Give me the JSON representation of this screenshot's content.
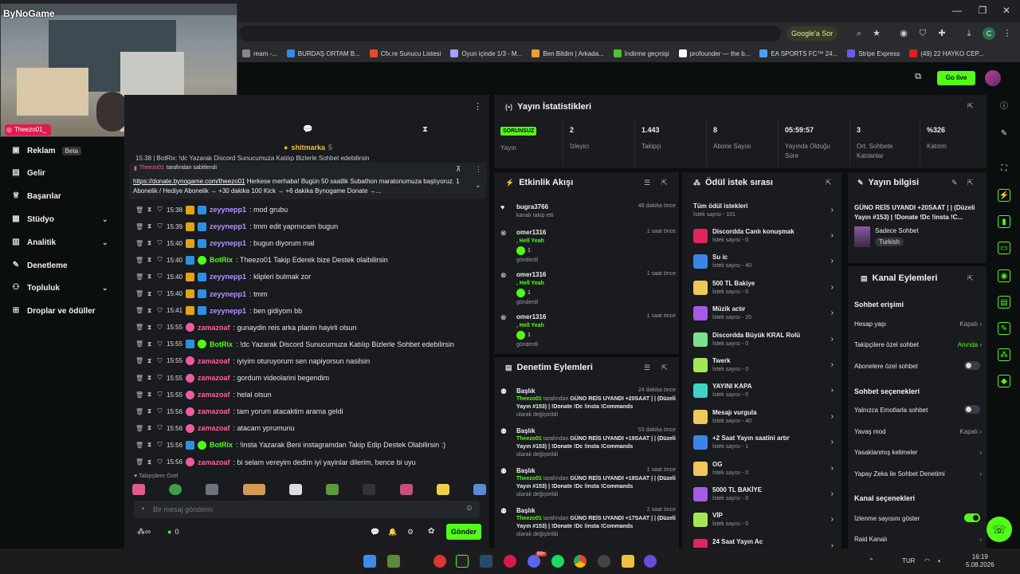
{
  "browser": {
    "google_ask": "Google'a Sor",
    "profile_initial": "C",
    "bookmarks": [
      "ream -...",
      "BURDAŞ ORTAM B...",
      "Cfx.re Sunucu Listesi",
      "Oyun içinde 1/3 - M...",
      "Ben Bildim | Arkada...",
      "İndirme geçmişi",
      "profounder — the b...",
      "EA SPORTS FC™ 24...",
      "Stripe Express",
      "(49) 22 HAYKO CEP..."
    ]
  },
  "header": {
    "go_live": "Go live"
  },
  "webcam": {
    "logo": "ByNoGame",
    "name": "Theezo01_"
  },
  "nav": {
    "items": [
      {
        "label": "Reklam",
        "badge": "Beta"
      },
      {
        "label": "Gelir"
      },
      {
        "label": "Başarılar"
      },
      {
        "label": "Stüdyo"
      },
      {
        "label": "Analitik"
      },
      {
        "label": "Denetleme"
      },
      {
        "label": "Topluluk"
      },
      {
        "label": "Droplar ve ödüller"
      }
    ]
  },
  "chat": {
    "gift_user": "shitmarka",
    "gift_count": "5",
    "partial_top": "15:38 | BotRix: !dc Yazarak Discord Sunucumuza Katılıp Bizlerle Sohbet edebilirsin",
    "pinned_by": "Theezo01",
    "pinned_label": "tarafından sabitlendi",
    "pinned_link": "https://donate.bynogame.com/theezo01",
    "pinned_text": "Herkese merhaba! Bugün 50 saatlik Subathon maratonumuza başlıyoruz. 1 Abonelik / Hediye Abonelik → +30 dakika 100 Kick → +6 dakika Bynogame Donate →...",
    "messages": [
      {
        "time": "15:38",
        "user": "zeyynepp1",
        "text": ": mod grubu",
        "type": "zey"
      },
      {
        "time": "15:39",
        "user": "zeyynepp1",
        "text": ": tmm edit yapmıcam bugun",
        "type": "zey"
      },
      {
        "time": "15:40",
        "user": "zeyynepp1",
        "text": ": bugun diyorum mal",
        "type": "zey"
      },
      {
        "time": "15:40",
        "user": "BotRix",
        "text": ": Theezo01 Takip Ederek bize Destek olaibilirsin",
        "type": "bot"
      },
      {
        "time": "15:40",
        "user": "zeyynepp1",
        "text": ": klipleri bulmak zor",
        "type": "zey"
      },
      {
        "time": "15:40",
        "user": "zeyynepp1",
        "text": ": tmm",
        "type": "zey"
      },
      {
        "time": "15:41",
        "user": "zeyynepp1",
        "text": ": ben gidiyom bb",
        "type": "zey"
      },
      {
        "time": "15:55",
        "user": "zamazoaf",
        "text": ": gunaydin reis arka planin hayirli olsun",
        "type": "zam"
      },
      {
        "time": "15:55",
        "user": "BotRix",
        "text": ": !dc Yazarak Discord Sunucumuza Katılıp Bizlerle Sohbet edebilirsin",
        "type": "bot"
      },
      {
        "time": "15:55",
        "user": "zamazoaf",
        "text": ": iyiyim oturuyorum sen napiyorsun nasilsin",
        "type": "zam"
      },
      {
        "time": "15:55",
        "user": "zamazoaf",
        "text": ": gordum videolarini begendim",
        "type": "zam"
      },
      {
        "time": "15:55",
        "user": "zamazoaf",
        "text": ": helal olsun",
        "type": "zam"
      },
      {
        "time": "15:56",
        "user": "zamazoaf",
        "text": ": tam yorum atacaktim arama geldi",
        "type": "zam"
      },
      {
        "time": "15:56",
        "user": "zamazoaf",
        "text": ": atacam yprumunu",
        "type": "zam"
      },
      {
        "time": "15:56",
        "user": "BotRix",
        "text": ": !insta Yazarak Beni instagramdan Takip Edip Destek Olabilirsin :)",
        "type": "bot"
      },
      {
        "time": "15:56",
        "user": "zamazoaf",
        "text": ": bi selam vereyim dedim iyi yayinlar dilerim, bence bi uyu",
        "type": "zam"
      }
    ],
    "followers_only": "Takipçilere Özel",
    "input_placeholder": "Bir mesaj gönderin",
    "send": "Gönder",
    "points": "0"
  },
  "stats": {
    "title": "Yayın İstatistikleri",
    "items": [
      {
        "value": "SORUNSUZ",
        "label": "Yayın"
      },
      {
        "value": "2",
        "label": "İzleyici"
      },
      {
        "value": "1.443",
        "label": "Takipçi"
      },
      {
        "value": "8",
        "label": "Abone Sayısı"
      },
      {
        "value": "05:59:57",
        "label": "Yayında Olduğu Süre"
      },
      {
        "value": "3",
        "label": "Ort. Sohbete Katılanlar"
      },
      {
        "value": "%326",
        "label": "Katılım"
      }
    ]
  },
  "activity": {
    "title": "Etkinlik Akışı",
    "items": [
      {
        "name": "bugra3766",
        "sub": "kanalı takip etti",
        "time": "48 dakika önce"
      },
      {
        "name": "omer1316",
        "reward": ", Hell Yeah",
        "count": "1",
        "sub": "gönderdi",
        "time": "1 saat önce"
      },
      {
        "name": "omer1316",
        "reward": ", Hell Yeah",
        "count": "1",
        "sub": "gönderdi",
        "time": "1 saat önce"
      },
      {
        "name": "omer1316",
        "reward": ", Hell Yeah",
        "count": "1",
        "sub": "gönderdi",
        "time": "1 saat önce"
      }
    ]
  },
  "moderation": {
    "title": "Denetim Eylemleri",
    "items": [
      {
        "head": "Başlık",
        "time": "24 dakika önce",
        "by": "Theezo01",
        "mid": "tarafından",
        "text": "GÜNO REİS UYANDI +20SAAT | | (Düzeli Yayın #153) | !Donate !Dc !insta !Commands",
        "tail": "olarak değiştirildi"
      },
      {
        "head": "Başlık",
        "time": "53 dakika önce",
        "by": "Theezo01",
        "mid": "tarafından",
        "text": "GÜNO REİS UYANDI +19SAAT | | (Düzeli Yayın #153) | !Donate !Dc !insta !Commands",
        "tail": "olarak değiştirildi"
      },
      {
        "head": "Başlık",
        "time": "1 saat önce",
        "by": "Theezo01",
        "mid": "tarafından",
        "text": "GÜNO REİS UYANDI +18SAAT | | (Düzeli Yayın #153) | !Donate !Dc !insta !Commands",
        "tail": "olarak değiştirildi"
      },
      {
        "head": "Başlık",
        "time": "2 saat önce",
        "by": "Theezo01",
        "mid": "tarafından",
        "text": "GÜNO REİS UYANDI +17SAAT | | (Düzeli Yayın #153) | !Donate !Dc !insta !Commands",
        "tail": "olarak değiştirildi"
      }
    ]
  },
  "rewards": {
    "title": "Ödül istek sırası",
    "all": {
      "name": "Tüm ödül istekleri",
      "sub": "İstek sayısı - 101"
    },
    "items": [
      {
        "name": "Discordda Canlı konuşmak",
        "sub": "İstek sayısı - 0",
        "color": "#e3245c"
      },
      {
        "name": "Su ic",
        "sub": "İstek sayısı - 40",
        "color": "#3a86e8"
      },
      {
        "name": "500 TL Bakiye",
        "sub": "İstek sayısı - 0",
        "color": "#f0c75a"
      },
      {
        "name": "Müzik actır",
        "sub": "İstek sayısı - 20",
        "color": "#a55be8"
      },
      {
        "name": "Discordda Büyük KRAL Rolü",
        "sub": "İstek sayısı - 0",
        "color": "#7de08a"
      },
      {
        "name": "Twerk",
        "sub": "İstek sayısı - 0",
        "color": "#a3e854"
      },
      {
        "name": "YAYINI KAPA",
        "sub": "İstek sayısı - 0",
        "color": "#3fd3c4"
      },
      {
        "name": "Mesajı vurgula",
        "sub": "İstek sayısı - 40",
        "color": "#f0c75a"
      },
      {
        "name": "+2 Saat Yayın saatini artır",
        "sub": "İstek sayısı - 1",
        "color": "#3a86e8"
      },
      {
        "name": "OG",
        "sub": "İstek sayısı - 0",
        "color": "#f0c75a"
      },
      {
        "name": "5000 TL BAKİYE",
        "sub": "İstek sayısı - 0",
        "color": "#a55be8"
      },
      {
        "name": "VİP",
        "sub": "İstek sayısı - 0",
        "color": "#a3e854"
      },
      {
        "name": "24 Saat Yayın Ac",
        "sub": "",
        "color": "#e3245c"
      }
    ]
  },
  "streaminfo": {
    "title": "Yayın bilgisi",
    "stream_title": "GÜNO REİS UYANDI +20SAAT | | (Düzeli Yayın #153) | !Donate !Dc !insta !C...",
    "category": "Sadece Sohbet",
    "language": "Turkish"
  },
  "channel": {
    "title": "Kanal Eylemleri",
    "chat_access": "Sohbet erişimi",
    "rows1": [
      {
        "label": "Hesap yaşı",
        "value": "Kapalı"
      },
      {
        "label": "Takipçilere özel sohbet",
        "value": "Anında"
      },
      {
        "label": "Abonelere özel sohbet",
        "value": ""
      }
    ],
    "chat_options": "Sohbet seçenekleri",
    "rows2": [
      {
        "label": "Yalnızca Emotlarla sohbet",
        "value": ""
      },
      {
        "label": "Yavaş mod",
        "value": "Kapalı"
      },
      {
        "label": "Yasaklanmış kelimeler",
        "value": ""
      },
      {
        "label": "Yapay Zeka ile Sohbet Denetimi",
        "value": ""
      }
    ],
    "channel_options": "Kanal seçenekleri",
    "rows3": [
      {
        "label": "İzlenme sayısını göster",
        "value": ""
      },
      {
        "label": "Raid Kanalı",
        "value": ""
      }
    ]
  },
  "taskbar": {
    "lang": "TUR",
    "time": "16:19",
    "date": "5.08.2026",
    "badge": "99+"
  }
}
